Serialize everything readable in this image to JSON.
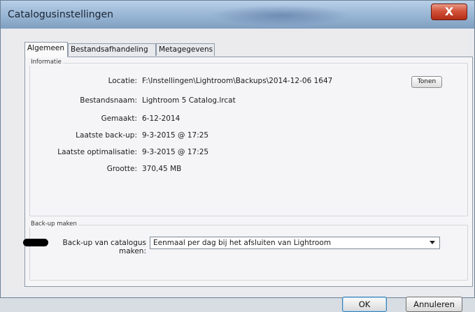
{
  "window": {
    "title": "Catalogusinstellingen",
    "close_glyph": "X"
  },
  "tabs": [
    {
      "label": "Algemeen",
      "active": true
    },
    {
      "label": "Bestandsafhandeling",
      "active": false
    },
    {
      "label": "Metagegevens",
      "active": false
    }
  ],
  "info": {
    "group_title": "Informatie",
    "rows": [
      {
        "label": "Locatie:",
        "value": "F:\\Instellingen\\Lightroom\\Backups\\2014-12-06 1647"
      },
      {
        "label": "Bestandsnaam:",
        "value": "Lightroom 5 Catalog.lrcat"
      },
      {
        "label": "Gemaakt:",
        "value": "6-12-2014"
      },
      {
        "label": "Laatste back-up:",
        "value": "9-3-2015 @ 17:25"
      },
      {
        "label": "Laatste optimalisatie:",
        "value": "9-3-2015 @ 17:25"
      },
      {
        "label": "Grootte:",
        "value": "370,45 MB"
      }
    ],
    "show_button": "Tonen"
  },
  "backup": {
    "group_title": "Back-up maken",
    "label": "Back-up van catalogus maken:",
    "selected": "Eenmaal per dag bij het afsluiten van Lightroom"
  },
  "buttons": {
    "ok": "OK",
    "cancel": "Annuleren"
  }
}
